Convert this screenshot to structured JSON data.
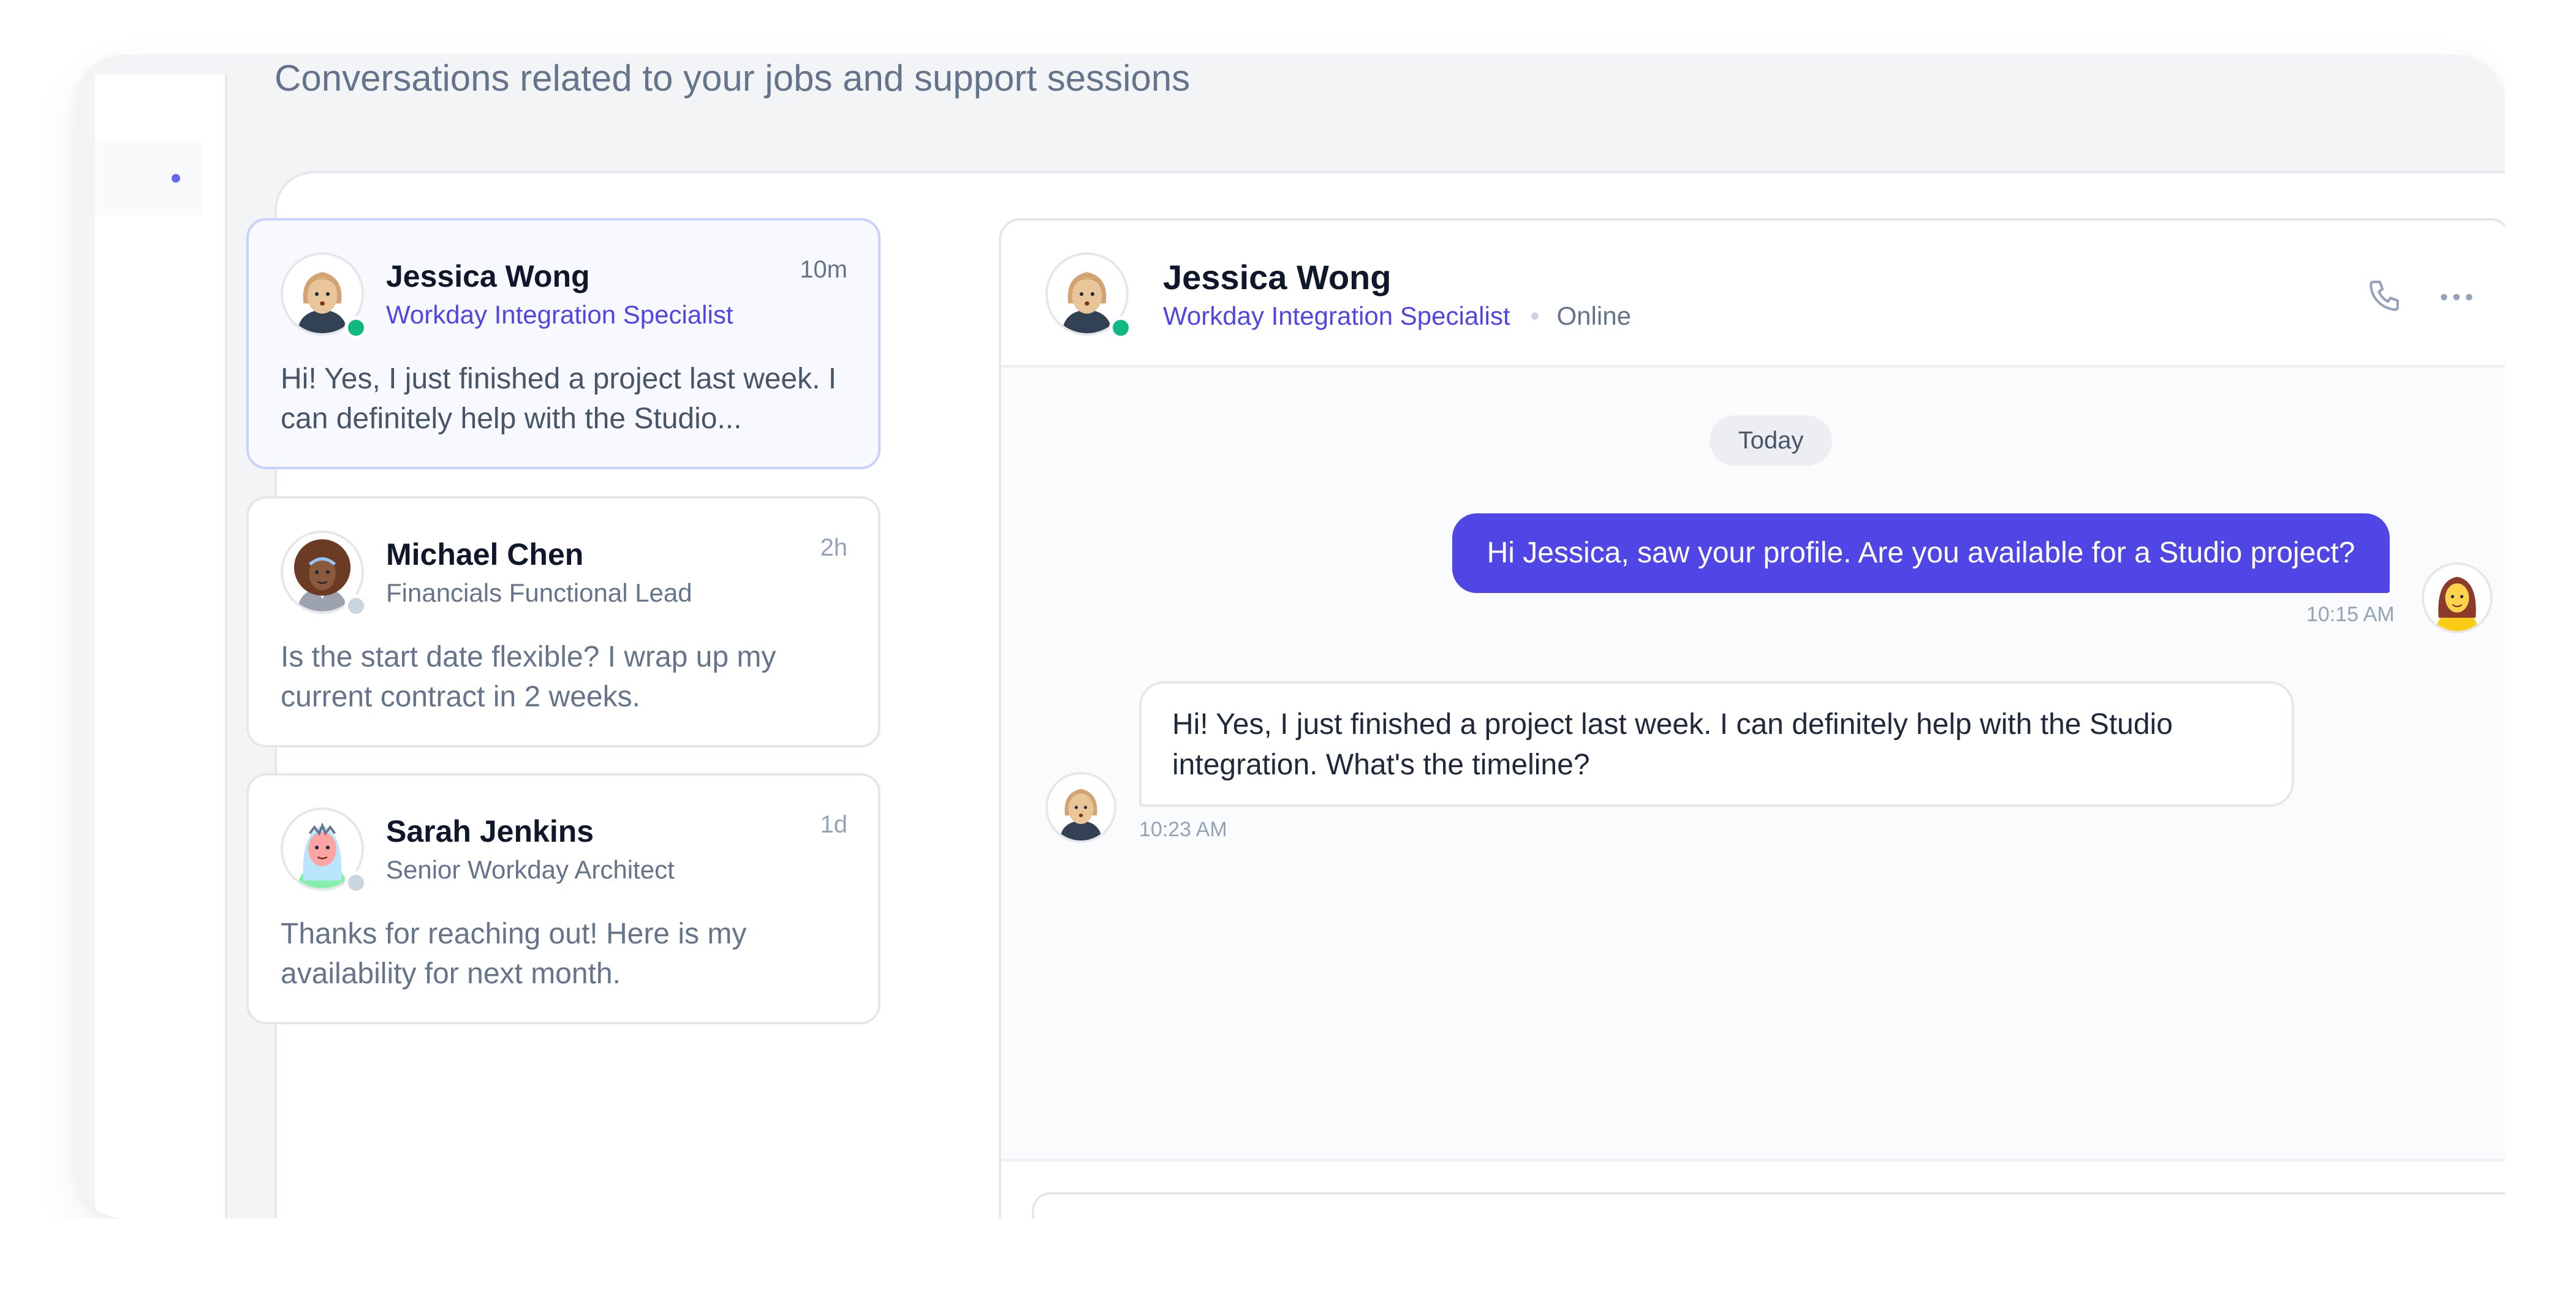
{
  "page": {
    "subtitle": "Conversations related to your jobs and support sessions"
  },
  "conversations": [
    {
      "name": "Jessica Wong",
      "role": "Workday Integration Specialist",
      "time": "10m",
      "preview": "Hi! Yes, I just finished a project last week. I can definitely help with the Studio...",
      "status": "online",
      "active": true
    },
    {
      "name": "Michael Chen",
      "role": "Financials Functional Lead",
      "time": "2h",
      "preview": "Is the start date flexible? I wrap up my current contract in 2 weeks.",
      "status": "offline",
      "active": false
    },
    {
      "name": "Sarah Jenkins",
      "role": "Senior Workday Architect",
      "time": "1d",
      "preview": "Thanks for reaching out! Here is my availability for next month.",
      "status": "offline",
      "active": false
    }
  ],
  "chat": {
    "name": "Jessica Wong",
    "role": "Workday Integration Specialist",
    "presence": "Online",
    "day_label": "Today",
    "messages": [
      {
        "direction": "outgoing",
        "text": "Hi Jessica, saw your profile. Are you available for a Studio project?",
        "time": "10:15 AM"
      },
      {
        "direction": "incoming",
        "text": "Hi! Yes, I just finished a project last week. I can definitely help with the Studio integration. What's the timeline?",
        "time": "10:23 AM"
      }
    ]
  },
  "icons": {
    "call": "phone-icon",
    "more": "more-horizontal-icon"
  },
  "colors": {
    "accent": "#4f46e5",
    "online": "#10b981",
    "offline": "#cbd5e1"
  }
}
